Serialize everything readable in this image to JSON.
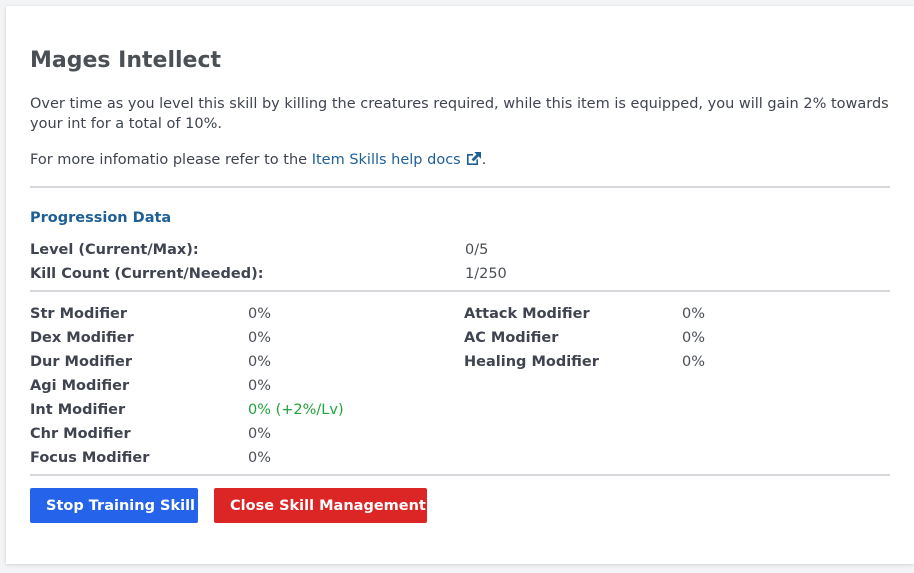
{
  "skill": {
    "title": "Mages Intellect",
    "description": "Over time as you level this skill by killing the creatures required, while this item is equipped, you will gain 2% towards your int for a total of 10%.",
    "more_info_prefix": "For more infomatio please refer to the ",
    "more_info_link": "Item Skills help docs",
    "more_info_suffix": "."
  },
  "progression": {
    "title": "Progression Data",
    "rows": [
      {
        "label": "Level (Current/Max):",
        "value": "0/5"
      },
      {
        "label": "Kill Count (Current/Needed):",
        "value": "1/250"
      }
    ]
  },
  "modifiers": {
    "left": [
      {
        "label": "Str Modifier",
        "value": "0%"
      },
      {
        "label": "Dex Modifier",
        "value": "0%"
      },
      {
        "label": "Dur Modifier",
        "value": "0%"
      },
      {
        "label": "Agi Modifier",
        "value": "0%"
      },
      {
        "label": "Int Modifier",
        "value": "0% (+2%/Lv)"
      },
      {
        "label": "Chr Modifier",
        "value": "0%"
      },
      {
        "label": "Focus Modifier",
        "value": "0%"
      }
    ],
    "right": [
      {
        "label": "Attack Modifier",
        "value": "0%"
      },
      {
        "label": "AC Modifier",
        "value": "0%"
      },
      {
        "label": "Healing Modifier",
        "value": "0%"
      }
    ]
  },
  "buttons": {
    "stop_training": "Stop Training Skill",
    "close_management": "Close Skill Management"
  },
  "colors": {
    "link": "#1e5f96",
    "highlight": "#20a33a",
    "primary_button": "#2563eb",
    "danger_button": "#dc2626"
  },
  "icons": {
    "link_icon": "external-link-icon"
  }
}
